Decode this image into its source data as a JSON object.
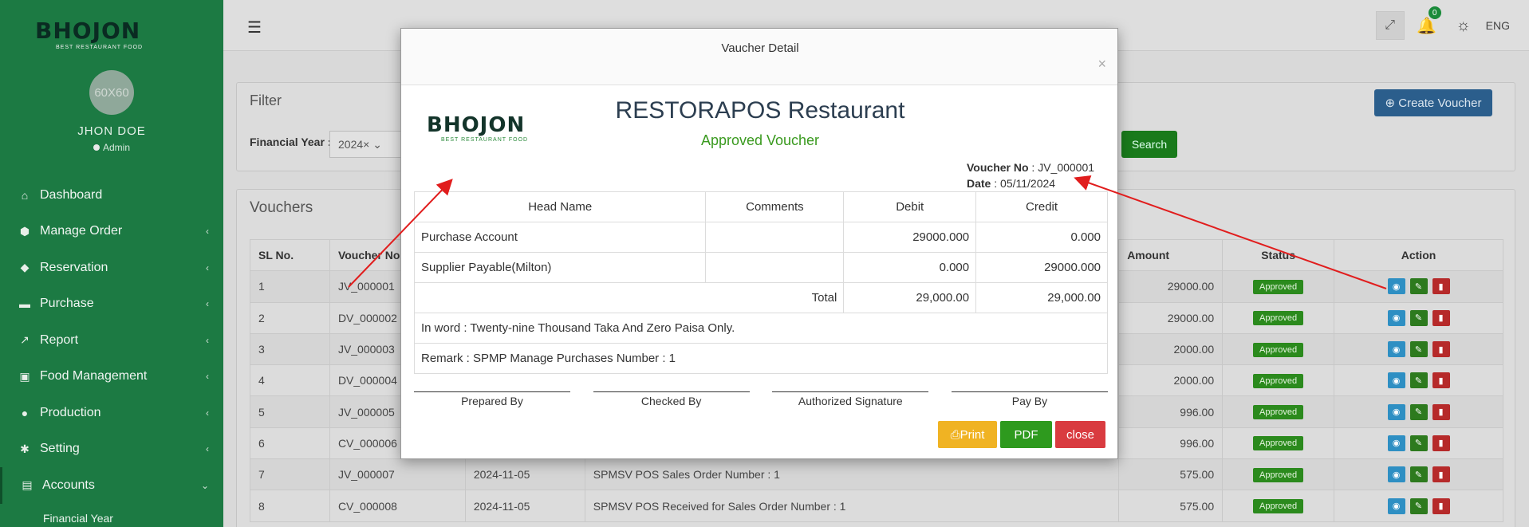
{
  "sidebar": {
    "logo": "BHOJON",
    "logo_tagline": "BEST RESTAURANT FOOD",
    "avatar_text": "60X60",
    "user_name": "JHON DOE",
    "user_role": "Admin",
    "items": [
      {
        "label": "Dashboard",
        "icon": "home-icon"
      },
      {
        "label": "Manage Order",
        "icon": "cube-icon"
      },
      {
        "label": "Reservation",
        "icon": "tag-icon"
      },
      {
        "label": "Purchase",
        "icon": "cart-icon"
      },
      {
        "label": "Report",
        "icon": "chart-icon"
      },
      {
        "label": "Food Management",
        "icon": "box-icon"
      },
      {
        "label": "Production",
        "icon": "production-icon"
      },
      {
        "label": "Setting",
        "icon": "gear-icon"
      },
      {
        "label": "Accounts",
        "icon": "calendar-icon"
      }
    ],
    "sub_item": "Financial Year"
  },
  "topbar": {
    "language": "ENG",
    "notification_count": "0"
  },
  "filter": {
    "title": "Filter",
    "financial_year_label": "Financial Year :",
    "financial_year_value": "2024×",
    "search_label": "Search",
    "create_label": "Create Voucher"
  },
  "vouchers": {
    "title": "Vouchers",
    "headers": [
      "SL No.",
      "Voucher No",
      "",
      "",
      "Amount",
      "Status",
      "Action"
    ],
    "rows": [
      {
        "sl": "1",
        "vno": "JV_000001",
        "date": "",
        "remark": "",
        "amount": "29000.00",
        "status": "Approved"
      },
      {
        "sl": "2",
        "vno": "DV_000002",
        "date": "",
        "remark": "",
        "amount": "29000.00",
        "status": "Approved"
      },
      {
        "sl": "3",
        "vno": "JV_000003",
        "date": "",
        "remark": "",
        "amount": "2000.00",
        "status": "Approved"
      },
      {
        "sl": "4",
        "vno": "DV_000004",
        "date": "",
        "remark": "",
        "amount": "2000.00",
        "status": "Approved"
      },
      {
        "sl": "5",
        "vno": "JV_000005",
        "date": "",
        "remark": "",
        "amount": "996.00",
        "status": "Approved"
      },
      {
        "sl": "6",
        "vno": "CV_000006",
        "date": "",
        "remark": "",
        "amount": "996.00",
        "status": "Approved"
      },
      {
        "sl": "7",
        "vno": "JV_000007",
        "date": "2024-11-05",
        "remark": "SPMSV POS Sales Order Number : 1",
        "amount": "575.00",
        "status": "Approved"
      },
      {
        "sl": "8",
        "vno": "CV_000008",
        "date": "2024-11-05",
        "remark": "SPMSV POS Received for Sales Order Number : 1",
        "amount": "575.00",
        "status": "Approved"
      }
    ]
  },
  "modal": {
    "title": "Vaucher Detail",
    "close_symbol": "×",
    "restaurant_name": "RESTORAPOS Restaurant",
    "status_text": "Approved Voucher",
    "voucher_no_label": "Voucher No",
    "voucher_no": "JV_000001",
    "date_label": "Date",
    "date": "05/11/2024",
    "table_headers": [
      "Head Name",
      "Comments",
      "Debit",
      "Credit"
    ],
    "lines": [
      {
        "head": "Purchase Account",
        "comment": "",
        "debit": "29000.000",
        "credit": "0.000"
      },
      {
        "head": "Supplier Payable(Milton)",
        "comment": "",
        "debit": "0.000",
        "credit": "29000.000"
      }
    ],
    "total_label": "Total",
    "total_debit": "29,000.00",
    "total_credit": "29,000.00",
    "in_word": "In word : Twenty-nine Thousand Taka And Zero Paisa Only.",
    "remark": "Remark : SPMP Manage Purchases Number : 1",
    "signatures": [
      "Prepared By",
      "Checked By",
      "Authorized Signature",
      "Pay By"
    ],
    "print_label": "Print",
    "pdf_label": "PDF",
    "close_label": "close"
  },
  "colors": {
    "sidebar": "#1c7a43",
    "approved": "#3a9a1f",
    "arrow": "#e11d1d"
  }
}
